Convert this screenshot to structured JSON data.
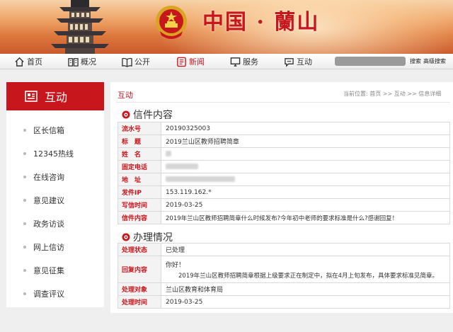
{
  "site": {
    "title": "中国 · 蘭山"
  },
  "nav": {
    "items": [
      {
        "label": "首页",
        "icon": "home-icon"
      },
      {
        "label": "概况",
        "icon": "book-open-icon"
      },
      {
        "label": "公开",
        "icon": "open-book-icon"
      },
      {
        "label": "新闻",
        "icon": "newspaper-icon",
        "active": true
      },
      {
        "label": "服务",
        "icon": "monitor-icon"
      },
      {
        "label": "互动",
        "icon": "chat-bubble-icon"
      }
    ],
    "search_label": "搜索",
    "advanced_search_label": "高级搜索"
  },
  "sidebar": {
    "header": "互动",
    "items": [
      {
        "label": "区长信箱"
      },
      {
        "label": "12345热线"
      },
      {
        "label": "在线咨询"
      },
      {
        "label": "意见建议"
      },
      {
        "label": "政务访谈"
      },
      {
        "label": "网上信访"
      },
      {
        "label": "意见征集"
      },
      {
        "label": "调查评议"
      }
    ]
  },
  "main": {
    "title": "互动",
    "breadcrumb": "当前位置: 首页 >> 互动 >> 信息详细"
  },
  "letter": {
    "section_title": "信件内容",
    "rows": [
      {
        "label": "流水号",
        "value": "20190325003"
      },
      {
        "label": "标　题",
        "value": "2019兰山区教师招聘简章"
      },
      {
        "label": "姓　名",
        "value": ""
      },
      {
        "label": "固定电话",
        "value": ""
      },
      {
        "label": "地　址",
        "value": ""
      },
      {
        "label": "发件IP",
        "value": "153.119.162.*"
      },
      {
        "label": "写信时间",
        "value": "2019-03-25"
      },
      {
        "label": "信件内容",
        "value": "2019年兰山区教师招聘简章什么时候发布?今年初中老师的要求标准是什么?感谢回复！"
      }
    ]
  },
  "handling": {
    "section_title": "办理情况",
    "status_label": "处理状态",
    "status_value": "已处理",
    "reply_label": "回复内容",
    "reply_greeting": "你好！",
    "reply_body": "2019年兰山区教师招聘简章根据上级要求正在制定中，拟在4月上旬发布，具体要求标准见简章。",
    "target_label": "处理对象",
    "target_value": "兰山区教育和体育局",
    "time_label": "处理时间",
    "time_value": "2019-03-25"
  },
  "colors": {
    "accent": "#c8161d",
    "label_bg": "#f3f3f3"
  }
}
